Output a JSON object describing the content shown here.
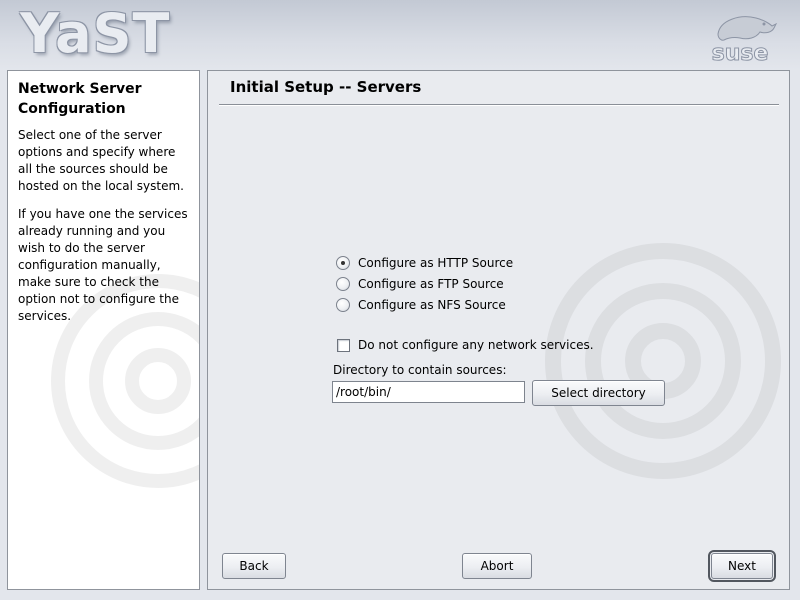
{
  "brand": {
    "app_logo_text": "YaST",
    "vendor_logo_text": "suse"
  },
  "help": {
    "title": "Network Server Configuration",
    "paragraphs": [
      "Select one of the server options and specify where all the sources should be hosted on the local system.",
      "If you have one the services already running and you wish to do the server configuration manually, make sure to check the option not to configure the services."
    ]
  },
  "main": {
    "title": "Initial Setup -- Servers",
    "radios": [
      {
        "label": "Configure as HTTP Source",
        "checked": true
      },
      {
        "label": "Configure as FTP Source",
        "checked": false
      },
      {
        "label": "Configure as NFS Source",
        "checked": false
      }
    ],
    "no_configure_checkbox": {
      "label": "Do not configure any network services.",
      "checked": false
    },
    "directory": {
      "label": "Directory to contain sources:",
      "value": "/root/bin/",
      "button_label": "Select directory"
    }
  },
  "footer": {
    "back_label": "Back",
    "abort_label": "Abort",
    "next_label": "Next"
  },
  "colors": {
    "background": "#e3e6ec",
    "panel_border": "#8f949c",
    "help_background": "#ffffff"
  }
}
